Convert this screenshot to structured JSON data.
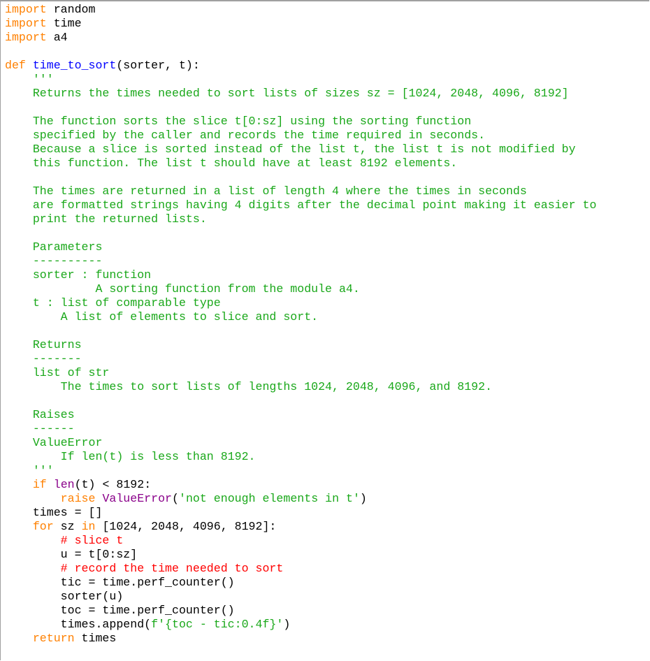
{
  "colors": {
    "keyword": "#ff8000",
    "function_name": "#0000ff",
    "string": "#1aa81a",
    "builtin": "#8a008a",
    "comment": "#ff0000",
    "default": "#000000"
  },
  "lines": [
    [
      {
        "t": "import",
        "c": "kw"
      },
      {
        "t": " random"
      }
    ],
    [
      {
        "t": "import",
        "c": "kw"
      },
      {
        "t": " time"
      }
    ],
    [
      {
        "t": "import",
        "c": "kw"
      },
      {
        "t": " a4"
      }
    ],
    [],
    [
      {
        "t": "def",
        "c": "kw"
      },
      {
        "t": " "
      },
      {
        "t": "time_to_sort",
        "c": "fn"
      },
      {
        "t": "(sorter, t):"
      }
    ],
    [
      {
        "t": "    '''",
        "c": "str"
      }
    ],
    [
      {
        "t": "    Returns the times needed to sort lists of sizes sz = [1024, 2048, 4096, 8192]",
        "c": "str"
      }
    ],
    [],
    [
      {
        "t": "    The function sorts the slice t[0:sz] using the sorting function",
        "c": "str"
      }
    ],
    [
      {
        "t": "    specified by the caller and records the time required in seconds.",
        "c": "str"
      }
    ],
    [
      {
        "t": "    Because a slice is sorted instead of the list t, the list t is not modified by",
        "c": "str"
      }
    ],
    [
      {
        "t": "    this function. The list t should have at least 8192 elements.",
        "c": "str"
      }
    ],
    [],
    [
      {
        "t": "    The times are returned in a list of length 4 where the times in seconds",
        "c": "str"
      }
    ],
    [
      {
        "t": "    are formatted strings having 4 digits after the decimal point making it easier to",
        "c": "str"
      }
    ],
    [
      {
        "t": "    print the returned lists.",
        "c": "str"
      }
    ],
    [],
    [
      {
        "t": "    Parameters",
        "c": "str"
      }
    ],
    [
      {
        "t": "    ----------",
        "c": "str"
      }
    ],
    [
      {
        "t": "    sorter : function",
        "c": "str"
      }
    ],
    [
      {
        "t": "             A sorting function from the module a4.",
        "c": "str"
      }
    ],
    [
      {
        "t": "    t : list of comparable type",
        "c": "str"
      }
    ],
    [
      {
        "t": "        A list of elements to slice and sort.",
        "c": "str"
      }
    ],
    [],
    [
      {
        "t": "    Returns",
        "c": "str"
      }
    ],
    [
      {
        "t": "    -------",
        "c": "str"
      }
    ],
    [
      {
        "t": "    list of str",
        "c": "str"
      }
    ],
    [
      {
        "t": "        The times to sort lists of lengths 1024, 2048, 4096, and 8192.",
        "c": "str"
      }
    ],
    [],
    [
      {
        "t": "    Raises",
        "c": "str"
      }
    ],
    [
      {
        "t": "    ------",
        "c": "str"
      }
    ],
    [
      {
        "t": "    ValueError",
        "c": "str"
      }
    ],
    [
      {
        "t": "        If len(t) is less than 8192.",
        "c": "str"
      }
    ],
    [
      {
        "t": "    '''",
        "c": "str"
      }
    ],
    [
      {
        "t": "    "
      },
      {
        "t": "if",
        "c": "kw"
      },
      {
        "t": " "
      },
      {
        "t": "len",
        "c": "bi"
      },
      {
        "t": "(t) < 8192:"
      }
    ],
    [
      {
        "t": "        "
      },
      {
        "t": "raise",
        "c": "kw"
      },
      {
        "t": " "
      },
      {
        "t": "ValueError",
        "c": "cls"
      },
      {
        "t": "("
      },
      {
        "t": "'not enough elements in t'",
        "c": "str"
      },
      {
        "t": ")"
      }
    ],
    [
      {
        "t": "    times = []"
      }
    ],
    [
      {
        "t": "    "
      },
      {
        "t": "for",
        "c": "kw"
      },
      {
        "t": " sz "
      },
      {
        "t": "in",
        "c": "kw"
      },
      {
        "t": " [1024, 2048, 4096, 8192]:"
      }
    ],
    [
      {
        "t": "        "
      },
      {
        "t": "# slice t",
        "c": "cm"
      }
    ],
    [
      {
        "t": "        u = t[0:sz]"
      }
    ],
    [
      {
        "t": "        "
      },
      {
        "t": "# record the time needed to sort",
        "c": "cm"
      }
    ],
    [
      {
        "t": "        tic = time.perf_counter()"
      }
    ],
    [
      {
        "t": "        sorter(u)"
      }
    ],
    [
      {
        "t": "        toc = time.perf_counter()"
      }
    ],
    [
      {
        "t": "        times.append("
      },
      {
        "t": "f'{toc - tic:0.4f}'",
        "c": "str"
      },
      {
        "t": ")"
      }
    ],
    [
      {
        "t": "    "
      },
      {
        "t": "return",
        "c": "kw"
      },
      {
        "t": " times"
      }
    ]
  ]
}
